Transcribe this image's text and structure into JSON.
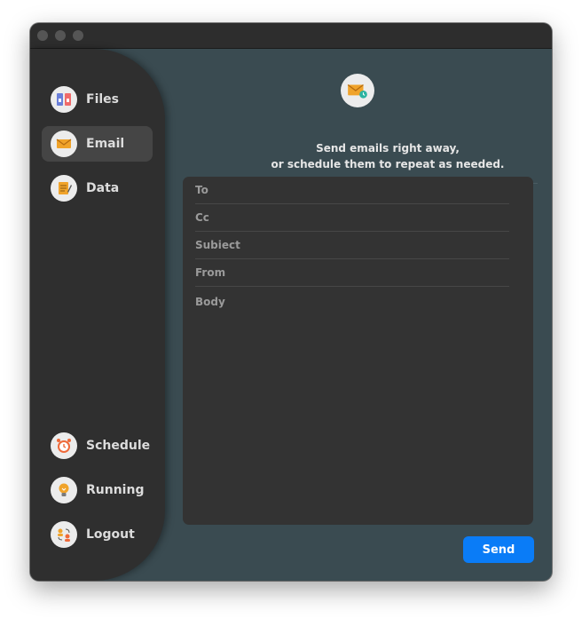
{
  "sidebar": {
    "top_items": [
      {
        "label": "Files",
        "icon": "folders-icon"
      },
      {
        "label": "Email",
        "icon": "envelope-icon",
        "active": true
      },
      {
        "label": "Data",
        "icon": "notepad-icon"
      }
    ],
    "bottom_items": [
      {
        "label": "Schedule",
        "icon": "alarm-clock-icon"
      },
      {
        "label": "Running",
        "icon": "lightbulb-icon"
      },
      {
        "label": "Logout",
        "icon": "switch-user-icon"
      }
    ]
  },
  "main": {
    "icon": "envelope-clock-icon",
    "headline_line1": "Send emails right away,",
    "headline_line2": "or schedule them to repeat as needed.",
    "form": {
      "to_placeholder": "To",
      "cc_placeholder": "Cc",
      "subject_placeholder": "Subiect",
      "from_placeholder": "From",
      "body_placeholder": "Body"
    },
    "send_label": "Send"
  },
  "colors": {
    "accent": "#0a7cf7",
    "window_bg": "#3a4b51",
    "sidebar_bg": "#2f2f2f",
    "form_bg": "#333333",
    "icon_orange": "#f0a32a"
  }
}
